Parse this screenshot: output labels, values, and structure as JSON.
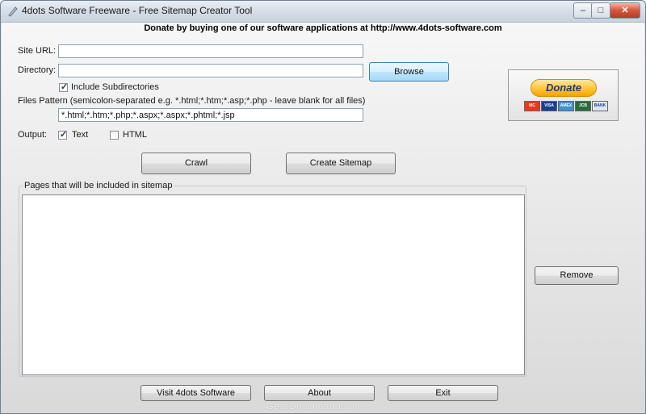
{
  "window": {
    "title": "4dots Software Freeware - Free Sitemap Creator Tool",
    "minimize_symbol": "–",
    "maximize_symbol": "□",
    "close_symbol": "✕"
  },
  "donate_message": "Donate by buying one of our software applications at http://www.4dots-software.com",
  "form": {
    "site_url_label": "Site URL:",
    "site_url_value": "",
    "directory_label": "Directory:",
    "directory_value": "",
    "browse_label": "Browse",
    "include_subdirs_label": "Include Subdirectories",
    "include_subdirs_checked": true,
    "files_pattern_label": "Files Pattern (semicolon-separated e.g. *.html;*.htm;*.asp;*.php - leave blank for all files)",
    "files_pattern_value": "*.html;*.htm;*.php;*.aspx;*.aspx;*.phtml;*.jsp",
    "output_label": "Output:",
    "text_option_label": "Text",
    "text_option_checked": true,
    "html_option_label": "HTML",
    "html_option_checked": false
  },
  "actions": {
    "crawl_label": "Crawl",
    "create_sitemap_label": "Create Sitemap",
    "remove_label": "Remove"
  },
  "pages_group": {
    "title": "Pages that will be included in sitemap",
    "items": []
  },
  "donate_button": {
    "label": "Donate",
    "cards": [
      "MC",
      "VISA",
      "AMEX",
      "JCB",
      "BANK"
    ]
  },
  "footer": {
    "visit_label": "Visit 4dots Software",
    "about_label": "About",
    "exit_label": "Exit"
  },
  "watermark": "GearDownload.com",
  "colors": {
    "accent": "#3c7fb1",
    "close_button": "#c8472d",
    "donate_gold": "#ffc43a"
  }
}
